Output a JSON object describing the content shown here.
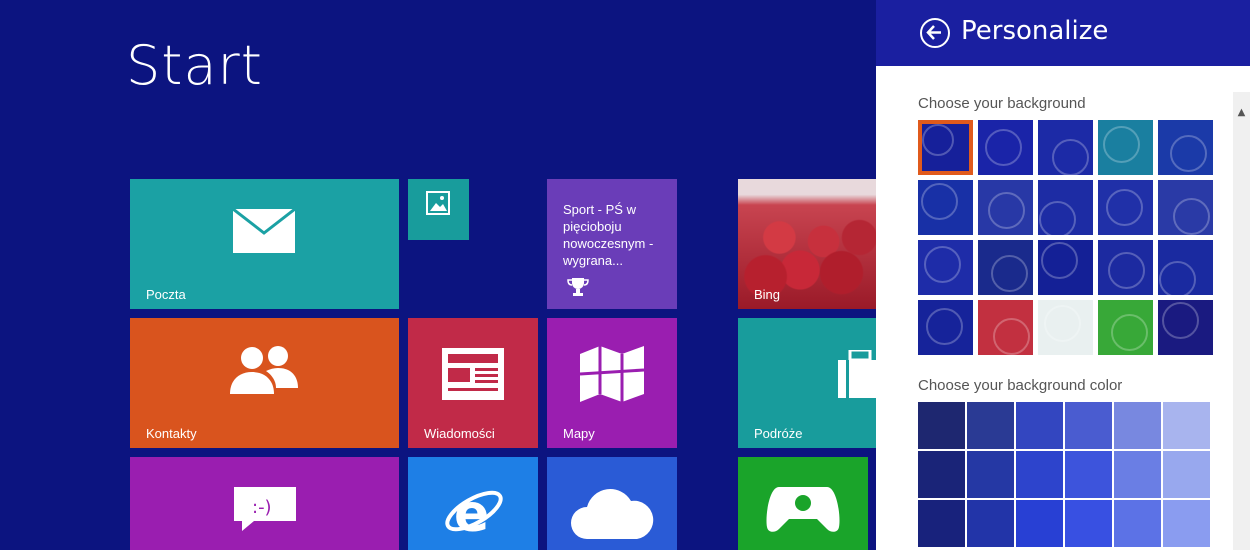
{
  "start": {
    "title": "Start"
  },
  "tiles": {
    "mail": {
      "label": "Poczta"
    },
    "photos": {
      "label": ""
    },
    "sport": {
      "text": "Sport - PŚ w pięcioboju nowoczesnym - wygrana...",
      "icon": "trophy-icon"
    },
    "bing": {
      "label": "Bing"
    },
    "contacts": {
      "label": "Kontakty"
    },
    "news": {
      "label": "Wiadomości"
    },
    "maps": {
      "label": "Mapy"
    },
    "travel": {
      "label": "Podróże"
    },
    "messaging": {
      "icon": "messaging-icon"
    },
    "ie": {
      "icon": "internet-explorer-icon"
    },
    "onedrive": {
      "icon": "cloud-icon"
    },
    "games": {
      "icon": "gamepad-icon"
    }
  },
  "panel": {
    "title": "Personalize",
    "background_section": "Choose your background",
    "color_section": "Choose your background color",
    "backgrounds": [
      {
        "bg": "#16209a",
        "selected": true
      },
      {
        "bg": "#1a24a8"
      },
      {
        "bg": "#1c2aa6"
      },
      {
        "bg": "#1a7fa0"
      },
      {
        "bg": "#1b3aa8"
      },
      {
        "bg": "#1830a6"
      },
      {
        "bg": "#2838a6"
      },
      {
        "bg": "#1d2ca4"
      },
      {
        "bg": "#2030a8"
      },
      {
        "bg": "#2a3aa6"
      },
      {
        "bg": "#1e2ca8"
      },
      {
        "bg": "#1a2a8c"
      },
      {
        "bg": "#142096"
      },
      {
        "bg": "#1c2aa0"
      },
      {
        "bg": "#1a2aa0"
      },
      {
        "bg": "#16239a"
      },
      {
        "bg": "#c23040"
      },
      {
        "bg": "#e9f0f0"
      },
      {
        "bg": "#38a838"
      },
      {
        "bg": "#1a1a80"
      }
    ],
    "colors": [
      "#1e2770",
      "#2a3a94",
      "#3346c0",
      "#4a5cd0",
      "#7888e0",
      "#a8b4ee",
      "#1a2478",
      "#2538a4",
      "#2d44cc",
      "#3d54dc",
      "#6a7ee4",
      "#98a8ee",
      "#18227c",
      "#2234a8",
      "#2840d4",
      "#3850e2",
      "#5c72e6",
      "#8a9cf0"
    ]
  }
}
